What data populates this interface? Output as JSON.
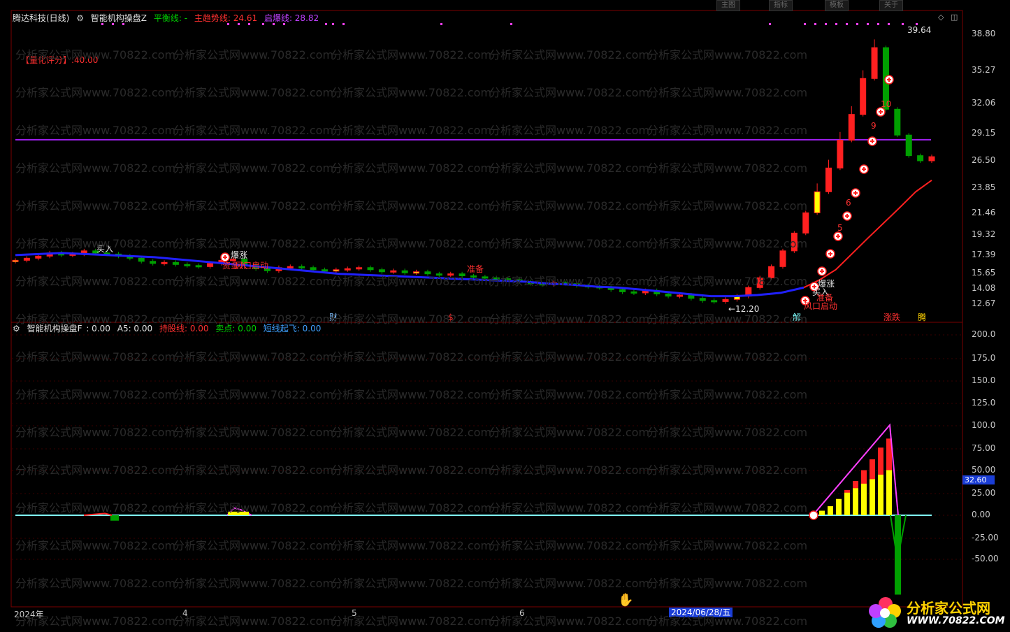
{
  "main_panel": {
    "stock_name": "腾达科技(日线)",
    "indicator_name": "智能机构操盘Z",
    "balance_label": "平衡线: -",
    "main_trend_label": "主趋势线: 24.61",
    "start_label": "启爆线: 28.82",
    "score_label": "【量化评分】:40.00",
    "price_ticks": [
      "38.80",
      "35.27",
      "32.06",
      "29.15",
      "26.50",
      "23.85",
      "21.46",
      "19.32",
      "17.39",
      "15.65",
      "14.08",
      "12.67"
    ],
    "high_label": "39.64",
    "low_label": "←12.20",
    "annotations": [
      "爆涨",
      "资金入",
      "风口启动",
      "买入",
      "准备",
      "爆涨",
      "买入",
      "准备",
      "风口启动",
      "涨跌",
      "财",
      "解",
      "腾",
      "$"
    ],
    "step_numbers": [
      "5",
      "6",
      "9",
      "10"
    ]
  },
  "sub_panel": {
    "indicator_name": "智能机构操盘F",
    "value_label": ": 0.00",
    "a5_label": "A5: 0.00",
    "hold_label": "持股线: 0.00",
    "sell_label": "卖点: 0.00",
    "short_label": "短线起飞: 0.00",
    "ticks": [
      "200.0",
      "175.0",
      "150.0",
      "125.0",
      "100.0",
      "75.00",
      "50.00",
      "25.00",
      "0.00",
      "-25.00",
      "-50.00"
    ],
    "current_value": "32.60"
  },
  "time_axis": {
    "labels": [
      "2024年",
      "4",
      "5",
      "6"
    ],
    "selected_date": "2024/06/28/五"
  },
  "tabs": [
    "主图",
    "指标",
    "模板",
    "关于"
  ],
  "watermark": "分析家公式网www.70822.com",
  "logo": {
    "cn": "分析家公式网",
    "url": "WWW.70822.COM"
  },
  "colors": {
    "up": "#ff2020",
    "down": "#00a000",
    "trend": "#2020ff",
    "start": "#a020f0",
    "bar_pos": "#ff2020",
    "bar_y": "#ffff00",
    "neg": "#00a000",
    "zero": "#80ffff"
  },
  "chart_data": {
    "type": "candlestick",
    "note_series": [
      {
        "name": "主趋势线",
        "values": [
          17.4,
          17.5,
          17.6,
          17.5,
          17.4,
          17.3,
          17.2,
          17.0,
          16.8,
          16.6,
          16.4,
          16.2,
          16.0,
          15.8,
          15.6,
          15.5,
          15.4,
          15.3,
          15.2,
          15.1,
          15.0,
          14.9,
          14.8,
          14.6,
          14.5,
          14.3,
          14.2,
          14.0,
          13.8,
          13.6,
          13.4,
          13.4,
          13.5,
          13.7,
          14.2,
          15.0,
          16.0,
          17.5,
          19.0,
          20.5,
          22.0,
          23.5,
          24.61
        ]
      },
      {
        "name": "启爆线",
        "values": [
          28.82
        ]
      }
    ],
    "close_prices": [
      16.9,
      17.1,
      17.3,
      17.6,
      17.4,
      17.5,
      17.8,
      17.6,
      17.5,
      17.3,
      17.1,
      16.8,
      16.6,
      16.7,
      16.5,
      16.4,
      16.3,
      16.6,
      16.9,
      17.0,
      16.4,
      16.1,
      15.9,
      16.2,
      16.3,
      16.2,
      16.0,
      15.9,
      16.0,
      16.1,
      16.2,
      16.0,
      15.8,
      15.9,
      15.7,
      15.8,
      15.6,
      15.5,
      15.6,
      15.4,
      15.3,
      15.2,
      15.1,
      15.0,
      14.8,
      14.6,
      14.5,
      14.7,
      14.6,
      14.4,
      14.3,
      14.2,
      14.0,
      13.8,
      13.7,
      13.9,
      13.6,
      13.4,
      13.5,
      13.2,
      13.0,
      12.9,
      13.1,
      13.4,
      14.2,
      15.2,
      16.3,
      17.8,
      19.5,
      21.5,
      23.5,
      25.8,
      28.5,
      31.0,
      34.5,
      37.5,
      31.5,
      29.0,
      27.0,
      26.5,
      26.9
    ],
    "sub_values": [
      0,
      0,
      0,
      0,
      0,
      0,
      0,
      0,
      0,
      0,
      0,
      0,
      0,
      0,
      0,
      0,
      0,
      0,
      0,
      0,
      0,
      0,
      0,
      0,
      0,
      0,
      0,
      0,
      0,
      0,
      0,
      0,
      0,
      0,
      0,
      0,
      0,
      0,
      0,
      0,
      0,
      0,
      0,
      0,
      0,
      0,
      0,
      0,
      0,
      0,
      0,
      0,
      0,
      0,
      0,
      0,
      0,
      0,
      0,
      0,
      0,
      0,
      5,
      10,
      15,
      20,
      25,
      30,
      35,
      40,
      45,
      50,
      55,
      60,
      65,
      -70,
      0,
      0,
      0,
      0,
      32.6
    ]
  }
}
